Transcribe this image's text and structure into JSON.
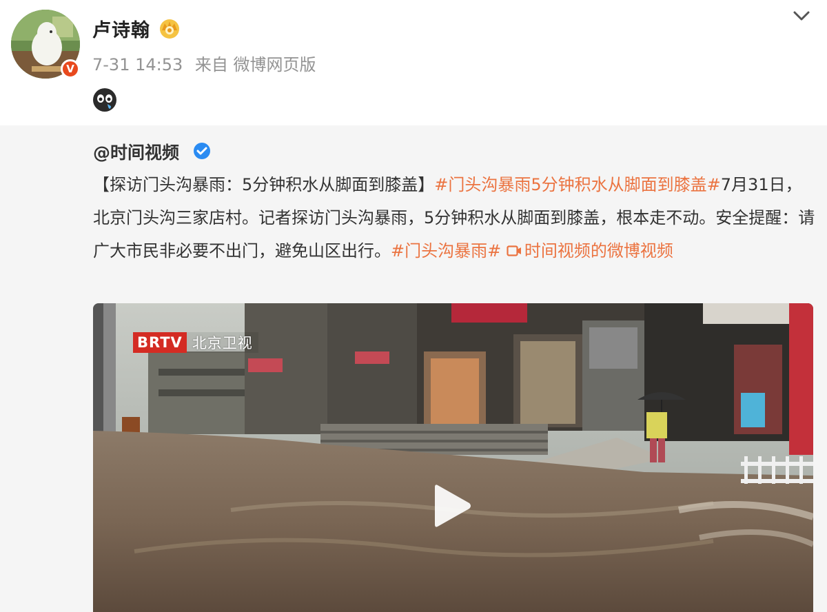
{
  "author": {
    "name": "卢诗翰",
    "badge_icon": "crown-icon",
    "verified_icon": "verified-badge-icon",
    "date": "7-31 14:53",
    "source": "来自 微博网页版",
    "emoji_icon": "crying-emoji-icon"
  },
  "repost": {
    "author": "@时间视频",
    "verified_icon": "blue-verified-icon",
    "text_intro": "【探访门头沟暴雨：5分钟积水从脚面到膝盖】",
    "hashtag_1": "#门头沟暴雨5分钟积水从脚面到膝盖#",
    "text_body": "7月31日，北京门头沟三家店村。记者探访门头沟暴雨，5分钟积水从脚面到膝盖，根本走不动。安全提醒：请广大市民非必要不出门，避免山区出行。",
    "hashtag_2": "#门头沟暴雨#",
    "video_link": "时间视频的微博视频"
  },
  "video": {
    "logo_brand": "BRTV",
    "logo_channel": "北京卫视",
    "play_icon": "play-icon"
  },
  "colors": {
    "accent": "#eb7340",
    "meta_gray": "#939393",
    "repost_bg": "#f5f5f5",
    "brtv_red": "#d42b23"
  }
}
